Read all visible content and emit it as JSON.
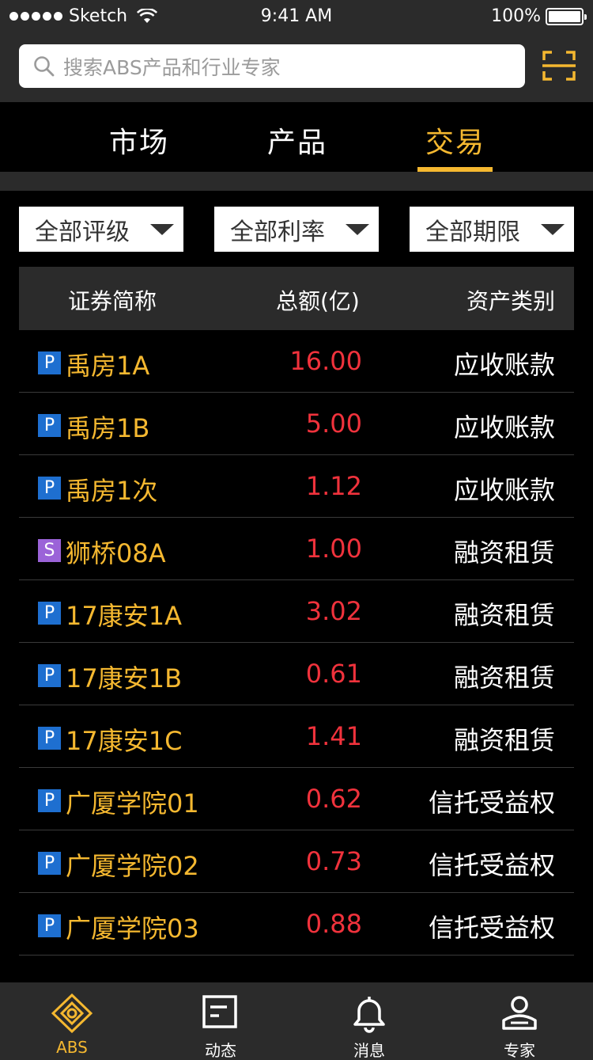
{
  "status_bar": {
    "carrier": "Sketch",
    "time": "9:41 AM",
    "battery": "100%"
  },
  "search": {
    "placeholder": "搜索ABS产品和行业专家"
  },
  "tabs": [
    {
      "label": "市场",
      "active": false
    },
    {
      "label": "产品",
      "active": false
    },
    {
      "label": "交易",
      "active": true
    }
  ],
  "filters": [
    {
      "label": "全部评级"
    },
    {
      "label": "全部利率"
    },
    {
      "label": "全部期限"
    }
  ],
  "table": {
    "headers": [
      "证券简称",
      "总额(亿)",
      "资产类别"
    ],
    "rows": [
      {
        "badge": "P",
        "name": "禹房1A",
        "amount": "16.00",
        "type": "应收账款"
      },
      {
        "badge": "P",
        "name": "禹房1B",
        "amount": "5.00",
        "type": "应收账款"
      },
      {
        "badge": "P",
        "name": "禹房1次",
        "amount": "1.12",
        "type": "应收账款"
      },
      {
        "badge": "S",
        "name": "狮桥08A",
        "amount": "1.00",
        "type": "融资租赁"
      },
      {
        "badge": "P",
        "name": "17康安1A",
        "amount": "3.02",
        "type": "融资租赁"
      },
      {
        "badge": "P",
        "name": "17康安1B",
        "amount": "0.61",
        "type": "融资租赁"
      },
      {
        "badge": "P",
        "name": "17康安1C",
        "amount": "1.41",
        "type": "融资租赁"
      },
      {
        "badge": "P",
        "name": "广厦学院01",
        "amount": "0.62",
        "type": "信托受益权"
      },
      {
        "badge": "P",
        "name": "广厦学院02",
        "amount": "0.73",
        "type": "信托受益权"
      },
      {
        "badge": "P",
        "name": "广厦学院03",
        "amount": "0.88",
        "type": "信托受益权"
      }
    ]
  },
  "bottom_nav": [
    {
      "label": "ABS",
      "icon": "abs-logo-icon",
      "active": true
    },
    {
      "label": "动态",
      "icon": "feed-icon",
      "active": false
    },
    {
      "label": "消息",
      "icon": "bell-icon",
      "active": false
    },
    {
      "label": "专家",
      "icon": "expert-icon",
      "active": false
    }
  ],
  "colors": {
    "accent": "#f5b830",
    "amount": "#f0323c",
    "badge_p": "#1e6fd0",
    "badge_s": "#9b63d8",
    "bar_bg": "#2b2b2b"
  }
}
